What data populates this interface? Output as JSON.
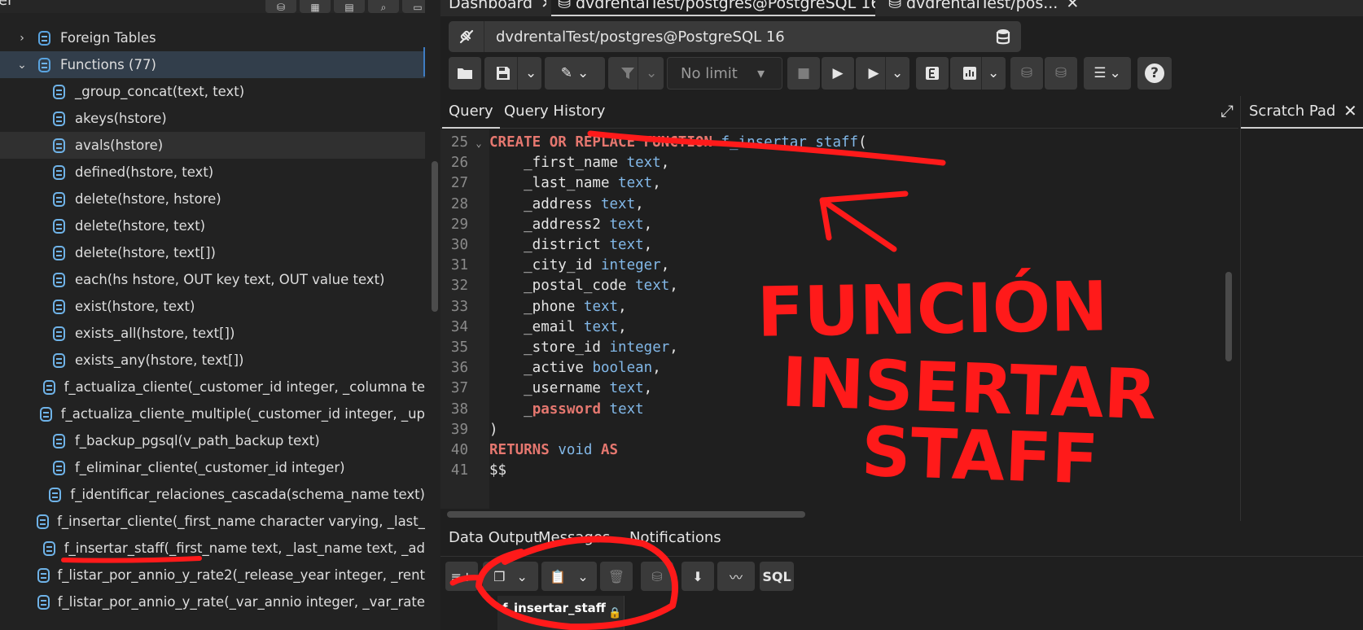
{
  "left_panel": {
    "clipped_title": "er",
    "toolbar_icons": [
      "object-explorer-icon",
      "table-grid-icon",
      "properties-icon",
      "search-icon",
      "terminal-icon"
    ],
    "tree": [
      {
        "label": "Foreign Tables",
        "icon": "foreign-table-icon",
        "chevron": "›",
        "level": 1
      },
      {
        "label": "Functions (77)",
        "icon": "functions-icon",
        "chevron": "⌄",
        "level": 1,
        "selected": true
      },
      {
        "label": "_group_concat(text, text)",
        "icon": "function-icon",
        "level": 2
      },
      {
        "label": "akeys(hstore)",
        "icon": "function-icon",
        "level": 2
      },
      {
        "label": "avals(hstore)",
        "icon": "function-icon",
        "level": 2,
        "hover": true
      },
      {
        "label": "defined(hstore, text)",
        "icon": "function-icon",
        "level": 2
      },
      {
        "label": "delete(hstore, hstore)",
        "icon": "function-icon",
        "level": 2
      },
      {
        "label": "delete(hstore, text)",
        "icon": "function-icon",
        "level": 2
      },
      {
        "label": "delete(hstore, text[])",
        "icon": "function-icon",
        "level": 2
      },
      {
        "label": "each(hs hstore, OUT key text, OUT value text)",
        "icon": "function-icon",
        "level": 2
      },
      {
        "label": "exist(hstore, text)",
        "icon": "function-icon",
        "level": 2
      },
      {
        "label": "exists_all(hstore, text[])",
        "icon": "function-icon",
        "level": 2
      },
      {
        "label": "exists_any(hstore, text[])",
        "icon": "function-icon",
        "level": 2
      },
      {
        "label": "f_actualiza_cliente(_customer_id integer, _columna te",
        "icon": "function-icon",
        "level": 2
      },
      {
        "label": "f_actualiza_cliente_multiple(_customer_id integer, _up",
        "icon": "function-icon",
        "level": 2
      },
      {
        "label": "f_backup_pgsql(v_path_backup text)",
        "icon": "function-icon",
        "level": 2
      },
      {
        "label": "f_eliminar_cliente(_customer_id integer)",
        "icon": "function-icon",
        "level": 2
      },
      {
        "label": "f_identificar_relaciones_cascada(schema_name text)",
        "icon": "function-icon",
        "level": 2
      },
      {
        "label": "f_insertar_cliente(_first_name character varying, _last_",
        "icon": "function-icon",
        "level": 2
      },
      {
        "label": "f_insertar_staff(_first_name text, _last_name text, _ad",
        "icon": "function-icon",
        "level": 2
      },
      {
        "label": "f_listar_por_annio_y_rate2(_release_year integer, _rent",
        "icon": "function-icon",
        "level": 2
      },
      {
        "label": "f_listar_por_annio_y_rate(_var_annio integer, _var_rate",
        "icon": "function-icon",
        "level": 2
      }
    ]
  },
  "tabs": [
    {
      "label": "Dashboard",
      "close": "✕"
    },
    {
      "label": "dvdrentalTest/postgres@PostgreSQL 16*",
      "close": "✕",
      "active": true
    },
    {
      "label": "dvdrentalTest/pos...",
      "close": "✕"
    }
  ],
  "connection": {
    "name": "dvdrentalTest/postgres@PostgreSQL 16",
    "caret": "⌄"
  },
  "toolbar": {
    "limit_label": "No limit",
    "limit_caret": "▾",
    "help": "?"
  },
  "query_tabs": [
    "Query",
    "Query History"
  ],
  "editor": {
    "lines": [
      {
        "n": "25",
        "fold": "⌄",
        "html": "<span class='kw'>CREATE OR REPLACE FUNCTION</span> <span class='fn'>f_insertar_staff</span>("
      },
      {
        "n": "26",
        "html": "    _first_name <span class='tp'>text</span>,"
      },
      {
        "n": "27",
        "html": "    _last_name <span class='tp'>text</span>,"
      },
      {
        "n": "28",
        "html": "    _address <span class='tp'>text</span>,"
      },
      {
        "n": "29",
        "html": "    _address2 <span class='tp'>text</span>,"
      },
      {
        "n": "30",
        "html": "    _district <span class='tp'>text</span>,"
      },
      {
        "n": "31",
        "html": "    _city_id <span class='tp'>integer</span>,"
      },
      {
        "n": "32",
        "html": "    _postal_code <span class='tp'>text</span>,"
      },
      {
        "n": "33",
        "html": "    _phone <span class='tp'>text</span>,"
      },
      {
        "n": "34",
        "html": "    _email <span class='tp'>text</span>,"
      },
      {
        "n": "35",
        "html": "    _store_id <span class='tp'>integer</span>,"
      },
      {
        "n": "36",
        "html": "    _active <span class='tp'>boolean</span>,"
      },
      {
        "n": "37",
        "html": "    _username <span class='tp'>text</span>,"
      },
      {
        "n": "38",
        "html": "    _<span class='kw'>password</span> <span class='tp'>text</span>"
      },
      {
        "n": "39",
        "html": ")"
      },
      {
        "n": "40",
        "html": "<span class='kw'>RETURNS</span> <span class='tp'>void</span> <span class='kw'>AS</span>"
      },
      {
        "n": "41",
        "html": "$$"
      }
    ]
  },
  "scratch_pad": {
    "title": "Scratch Pad",
    "close": "✕"
  },
  "output_tabs": [
    "Data Output",
    "Messages",
    "Notifications"
  ],
  "output_toolbar": {
    "sql_label": "SQL"
  },
  "result_tab": {
    "label": "f_insertar_staff",
    "lock": "🔒"
  },
  "annotation": {
    "text_lines": [
      "FUNCIÓN",
      "INSERTAR",
      "STAFF"
    ],
    "color": "#ff1a1a"
  },
  "colors": {
    "accent": "#3f7cc2",
    "keyword": "#e5776f",
    "type": "#82b8e8",
    "icon": "#6fb3e8"
  }
}
